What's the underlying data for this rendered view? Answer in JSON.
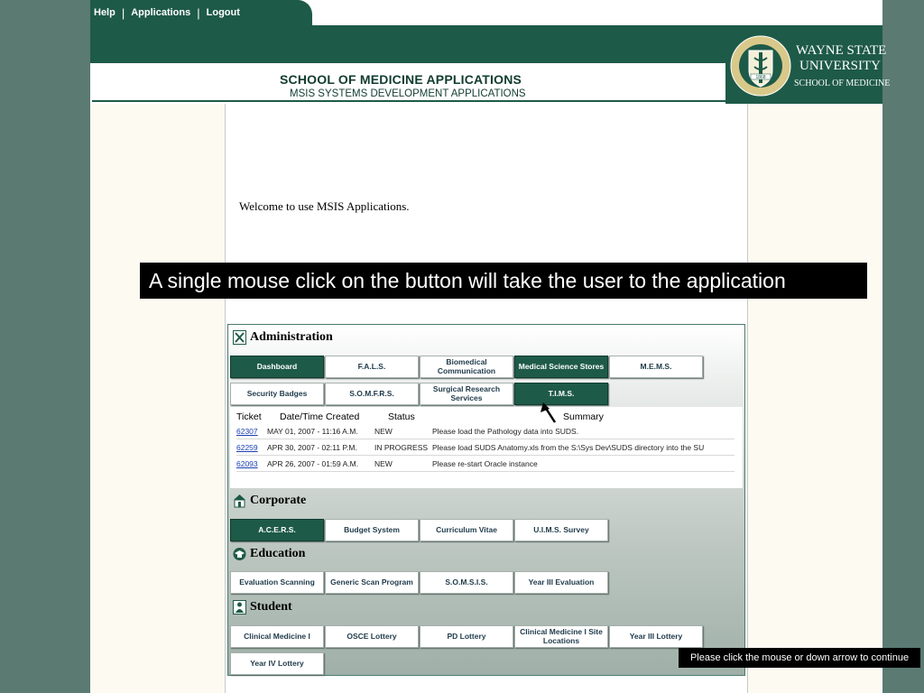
{
  "nav": {
    "help": "Help",
    "applications": "Applications",
    "logout": "Logout"
  },
  "header": {
    "title": "SCHOOL OF MEDICINE APPLICATIONS",
    "subtitle": "MSIS SYSTEMS DEVELOPMENT APPLICATIONS",
    "logo_line1": "WAYNE STATE",
    "logo_line2": "UNIVERSITY",
    "logo_line3": "SCHOOL OF MEDICINE",
    "seal_text": [
      "MEDICAL EDUCATION",
      "PATIENT CARE",
      "RESEARCH",
      "1868"
    ]
  },
  "welcome": "Welcome to use MSIS Applications.",
  "banner": "A single mouse click on the button will take the user to the application",
  "sections": {
    "administration": {
      "title": "Administration",
      "buttons": [
        "Dashboard",
        "F.A.L.S.",
        "Biomedical Communication",
        "Medical Science Stores",
        "M.E.M.S.",
        "Security Badges",
        "S.O.M.F.R.S.",
        "Surgical Research Services",
        "T.I.M.S."
      ]
    },
    "corporate": {
      "title": "Corporate",
      "buttons": [
        "A.C.E.R.S.",
        "Budget System",
        "Curriculum Vitae",
        "U.I.M.S. Survey"
      ]
    },
    "education": {
      "title": "Education",
      "buttons": [
        "Evaluation Scanning",
        "Generic Scan Program",
        "S.O.M.S.I.S.",
        "Year III Evaluation"
      ]
    },
    "student": {
      "title": "Student",
      "buttons": [
        "Clinical Medicine I",
        "OSCE Lottery",
        "PD Lottery",
        "Clinical Medicine I Site Locations",
        "Year III Lottery",
        "Year IV Lottery"
      ]
    }
  },
  "tickets": {
    "headers": [
      "Ticket",
      "Date/Time Created",
      "Status",
      "Summary"
    ],
    "rows": [
      {
        "ticket": "62307",
        "date": "MAY 01, 2007 - 11:16 A.M.",
        "status": "NEW",
        "summary": "Please load the Pathology data into SUDS."
      },
      {
        "ticket": "62259",
        "date": "APR 30, 2007 - 02:11 P.M.",
        "status": "IN PROGRESS",
        "summary": "Please load SUDS Anatomy.xls from the S:\\Sys Dev\\SUDS directory into the SU"
      },
      {
        "ticket": "62093",
        "date": "APR 26, 2007 - 01:59 A.M.",
        "status": "NEW",
        "summary": "Please re-start Oracle instance"
      }
    ]
  },
  "continue_hint": "Please click the mouse or down arrow to continue",
  "colors": {
    "green": "#1e5a48",
    "frame_bg": "#5a7a72",
    "side_bg": "#fdfaf2"
  }
}
